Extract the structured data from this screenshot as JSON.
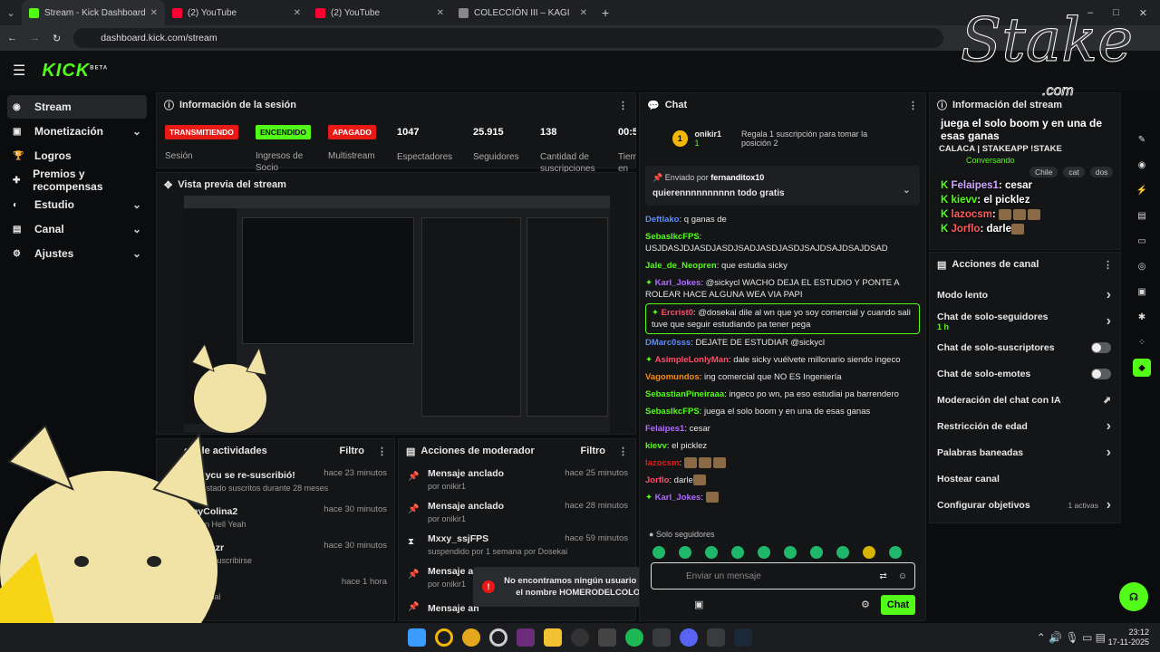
{
  "tabs": [
    {
      "label": "Stream - Kick Dashboard",
      "color": "#53fc18"
    },
    {
      "label": "(2) YouTube",
      "color": "#ff0033"
    },
    {
      "label": "(2) YouTube",
      "color": "#ff0033"
    },
    {
      "label": "COLECCIÓN III – KAGI",
      "color": "#888888"
    }
  ],
  "url": "dashboard.kick.com/stream",
  "brand": "KICK",
  "beta": "BETA",
  "sidebar": [
    {
      "label": "Stream",
      "icon": "stream-icon",
      "chev": ""
    },
    {
      "label": "Monetización",
      "icon": "money-icon",
      "chev": "⌄"
    },
    {
      "label": "Logros",
      "icon": "trophy-icon",
      "chev": ""
    },
    {
      "label": "Premios y recompensas",
      "icon": "gift-icon",
      "chev": ""
    },
    {
      "label": "Estudio",
      "icon": "studio-icon",
      "chev": "⌄"
    },
    {
      "label": "Canal",
      "icon": "channel-icon",
      "chev": "⌄"
    },
    {
      "label": "Ajustes",
      "icon": "gear-icon",
      "chev": "⌄"
    }
  ],
  "session": {
    "title": "Información de la sesión",
    "badges": [
      {
        "text": "TRANSMITIENDO",
        "label": "Sesión",
        "bg": "#e91916",
        "fg": "#ffffff"
      },
      {
        "text": "ENCENDIDO",
        "label": "Ingresos de Socio",
        "bg": "#53fc18",
        "fg": "#0b0c0e"
      },
      {
        "text": "APAGADO",
        "label": "Multistream",
        "bg": "#e91916",
        "fg": "#ffffff"
      }
    ],
    "stats": [
      {
        "value": "1047",
        "label": "Espectadores"
      },
      {
        "value": "25.915",
        "label": "Seguidores"
      },
      {
        "value": "138",
        "label": "Cantidad de suscripciones"
      },
      {
        "value": "00:5",
        "label": "Tiem en vi"
      }
    ]
  },
  "preview": {
    "title": "Vista previa del stream"
  },
  "activity": {
    "title": "ed de actividades",
    "filter": "Filtro",
    "items": [
      {
        "title": "¡Matycu se re-suscribió!",
        "sub": "han estado suscritos durante 28 meses",
        "time": "hace 23 minutos"
      },
      {
        "title": "ReyColina2",
        "sub": "ciló un Hell Yeah",
        "time": "hace 30 minutos"
      },
      {
        "title": "misalazr",
        "sub": "aba de suscribirse",
        "time": "hace 30 minutos"
      },
      {
        "title": "vusky",
        "sub": "ir el canal",
        "time": "hace 1 hora"
      }
    ]
  },
  "modactions": {
    "title": "Acciones de moderador",
    "filter": "Filtro",
    "items": [
      {
        "title": "Mensaje anclado",
        "sub": "por onikir1",
        "time": "hace 25 minutos"
      },
      {
        "title": "Mensaje anclado",
        "sub": "por onikir1",
        "time": "hace 28 minutos"
      },
      {
        "title": "Mxxy_ssjFPS",
        "sub": "suspendido por 1 semana por Dosekai",
        "time": "hace 59 minutos"
      },
      {
        "title": "Mensaje an",
        "sub": "por onikir1",
        "time": ""
      },
      {
        "title": "Mensaje an",
        "sub": "",
        "time": ""
      }
    ]
  },
  "toast": {
    "text": "No encontramos ningún usuario con el nombre HOMERODELCOLO."
  },
  "chat": {
    "title": "Chat",
    "top_user": "onikir1",
    "top_count": "1",
    "top_text": "Regala 1 suscripción para tomar la posición 2",
    "pinned_by_label": "Enviado por",
    "pinned_by": "fernanditox10",
    "pinned_text": "quierennnnnnnnnn todo gratis",
    "messages": [
      {
        "user": "Deftlako",
        "color": "#5b8cff",
        "text": "q ganas de"
      },
      {
        "user": "SebasIkcFPS",
        "color": "#53fc18",
        "text": "USJDASJDJASDJASDJSADJASDJASDJSAJDSAJDSAJDSAD"
      },
      {
        "user": "Jale_de_Neopren",
        "color": "#53fc18",
        "text": "que estudia sicky"
      },
      {
        "user": "Karl_Jokes",
        "color": "#b06cff",
        "text": "@sickycl WACHO DEJA EL ESTUDIO Y PONTE A ROLEAR HACE ALGUNA WEA VIA PAPI"
      },
      {
        "user": "Ercrist0",
        "color": "#ff4d6a",
        "text": "@dosekai dile al wn que yo soy comercial y cuando sali tuve que seguir estudiando pa tener pega"
      },
      {
        "user": "DMarc0sss",
        "color": "#5b8cff",
        "text": "DEJATE DE ESTUDIAR @sickycl"
      },
      {
        "user": "AsimpleLonlyMan",
        "color": "#ff4d6a",
        "text": "dale sicky vuélvete millonario siendo ingeco"
      },
      {
        "user": "Vagomundos",
        "color": "#ff8a00",
        "text": "ing comercial que NO ES Ingeniería"
      },
      {
        "user": "SebastianPineiraaa",
        "color": "#53fc18",
        "text": "ingeco po wn, pa eso estudiai pa barrendero"
      },
      {
        "user": "SebasIkcFPS",
        "color": "#53fc18",
        "text": "juega el solo boom y en una de esas ganas"
      },
      {
        "user": "Felaipes1",
        "color": "#b06cff",
        "text": "cesar"
      },
      {
        "user": "kievv",
        "color": "#53fc18",
        "text": "el picklez"
      },
      {
        "user": "lazocsm",
        "color": "#e91916",
        "text": ""
      },
      {
        "user": "Jorflo",
        "color": "#ff4d6a",
        "text": "darle"
      },
      {
        "user": "Karl_Jokes",
        "color": "#b06cff",
        "text": ""
      }
    ],
    "followers_only": "Solo seguidores",
    "input_placeholder": "Enviar un mensaje",
    "send_label": "Chat"
  },
  "right_top": {
    "title": "Información del stream",
    "overlay_title": "juega el solo boom y en una de esas ganas",
    "overlay_sub": "CALACA | STAKEAPP !STAKE",
    "category": "Conversando",
    "tags": [
      "Chile",
      "cat",
      "dos"
    ],
    "lines": [
      {
        "user": "Felaipes1",
        "text": "cesar"
      },
      {
        "user": "kievv",
        "text": "el picklez"
      },
      {
        "user": "lazocsm",
        "text": ""
      },
      {
        "user": "Jorflo",
        "text": "darle"
      }
    ]
  },
  "channel_actions": {
    "title": "Acciones de canal",
    "items": [
      {
        "label": "Modo lento",
        "control": "chevron",
        "sub": ""
      },
      {
        "label": "Chat de solo-seguidores",
        "control": "chevron",
        "sub": "1 h"
      },
      {
        "label": "Chat de solo-suscriptores",
        "control": "toggle",
        "sub": ""
      },
      {
        "label": "Chat de solo-emotes",
        "control": "toggle",
        "sub": ""
      },
      {
        "label": "Moderación del chat con IA",
        "control": "external",
        "sub": ""
      },
      {
        "label": "Restricción de edad",
        "control": "chevron",
        "sub": ""
      },
      {
        "label": "Palabras baneadas",
        "control": "chevron",
        "sub": ""
      },
      {
        "label": "Hostear canal",
        "control": "none",
        "sub": ""
      },
      {
        "label": "Configurar objetivos",
        "control": "chevron",
        "sub": "1 activas"
      }
    ]
  },
  "watermark": {
    "brand": "Stake",
    "suffix": ".com"
  },
  "clock": {
    "time": "23:12",
    "date": "17-11-2025"
  }
}
